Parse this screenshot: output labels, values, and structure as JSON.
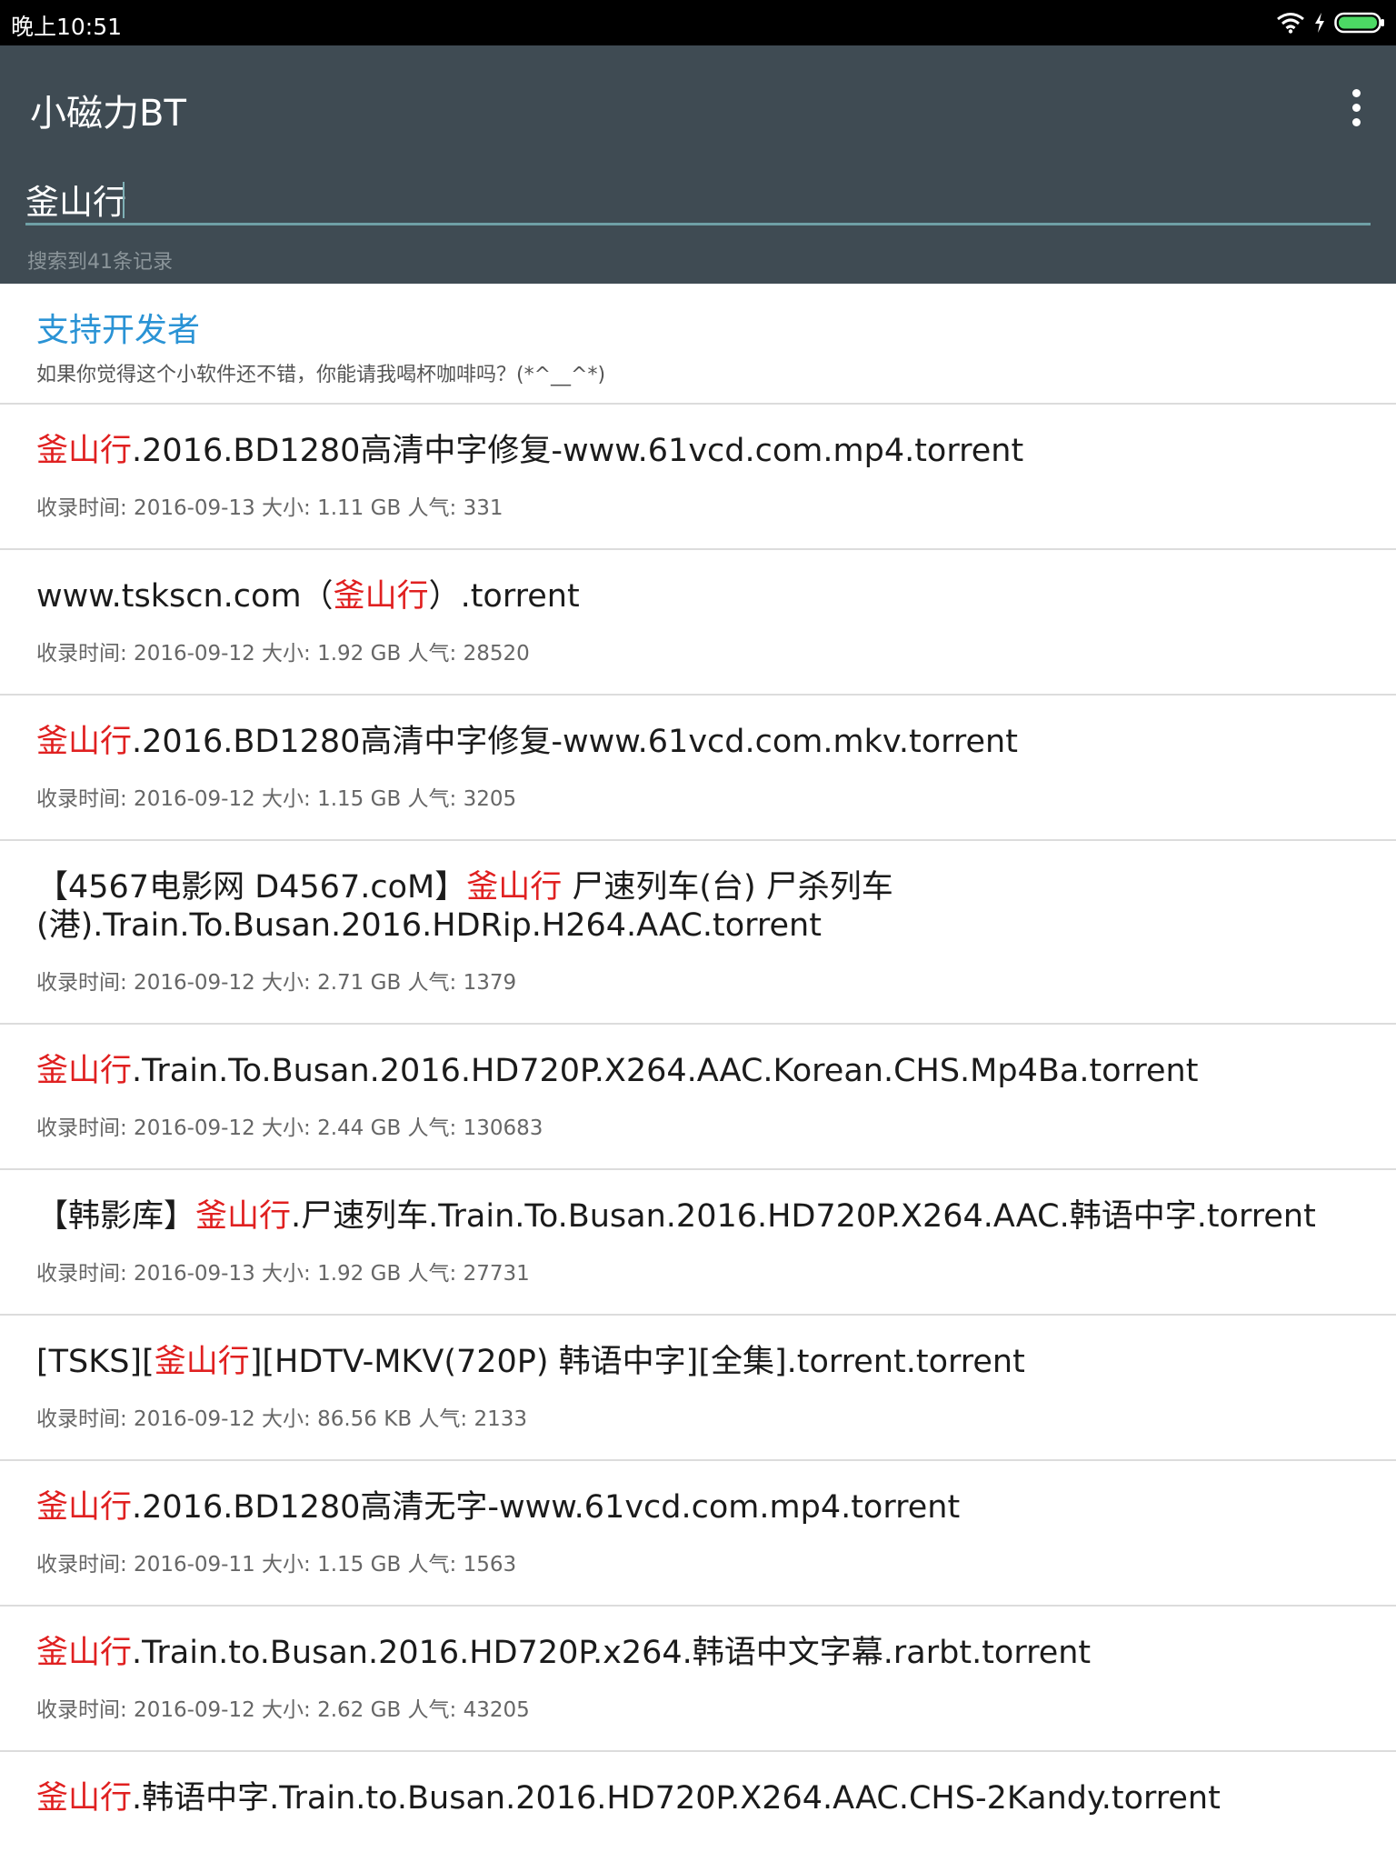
{
  "status_bar": {
    "time": "晚上10:51",
    "icons": [
      "wifi-icon",
      "charging-icon",
      "battery-icon"
    ],
    "battery_color": "#4cd964"
  },
  "app": {
    "title": "小磁力BT",
    "overflow_icon": "more-vert-icon"
  },
  "search": {
    "value": "釜山行",
    "count_text": "搜索到41条记录"
  },
  "support": {
    "title": "支持开发者",
    "description": "如果你觉得这个小软件还不错，你能请我喝杯咖啡吗？(*^__^*)"
  },
  "colors": {
    "appbar": "#3f4b53",
    "highlight": "#e02020",
    "link": "#2a93d5"
  },
  "results": [
    {
      "parts": [
        {
          "t": "釜山行",
          "hl": true
        },
        {
          "t": ".2016.BD1280高清中字修复-www.61vcd.com.mp4.torrent",
          "hl": false
        }
      ],
      "meta": "收录时间: 2016-09-13 大小: 1.11 GB 人气: 331"
    },
    {
      "parts": [
        {
          "t": "www.tskscn.com（",
          "hl": false
        },
        {
          "t": "釜山行",
          "hl": true
        },
        {
          "t": "）.torrent",
          "hl": false
        }
      ],
      "meta": "收录时间: 2016-09-12 大小: 1.92 GB 人气: 28520"
    },
    {
      "parts": [
        {
          "t": "釜山行",
          "hl": true
        },
        {
          "t": ".2016.BD1280高清中字修复-www.61vcd.com.mkv.torrent",
          "hl": false
        }
      ],
      "meta": "收录时间: 2016-09-12 大小: 1.15 GB 人气: 3205"
    },
    {
      "parts": [
        {
          "t": "【4567电影网 D4567.coM】",
          "hl": false
        },
        {
          "t": "釜山行",
          "hl": true
        },
        {
          "t": " 尸速列车(台) 尸杀列车(港).Train.To.Busan.2016.HDRip.H264.AAC.torrent",
          "hl": false
        }
      ],
      "meta": "收录时间: 2016-09-12 大小: 2.71 GB 人气: 1379"
    },
    {
      "parts": [
        {
          "t": "釜山行",
          "hl": true
        },
        {
          "t": ".Train.To.Busan.2016.HD720P.X264.AAC.Korean.CHS.Mp4Ba.torrent",
          "hl": false
        }
      ],
      "meta": "收录时间: 2016-09-12 大小: 2.44 GB 人气: 130683"
    },
    {
      "parts": [
        {
          "t": "【韩影库】",
          "hl": false
        },
        {
          "t": "釜山行",
          "hl": true
        },
        {
          "t": ".尸速列车.Train.To.Busan.2016.HD720P.X264.AAC.韩语中字.torrent",
          "hl": false
        }
      ],
      "meta": "收录时间: 2016-09-13 大小: 1.92 GB 人气: 27731"
    },
    {
      "parts": [
        {
          "t": "[TSKS][",
          "hl": false
        },
        {
          "t": "釜山行",
          "hl": true
        },
        {
          "t": "][HDTV-MKV(720P) 韩语中字][全集].torrent.torrent",
          "hl": false
        }
      ],
      "meta": "收录时间: 2016-09-12 大小: 86.56 KB 人气: 2133"
    },
    {
      "parts": [
        {
          "t": "釜山行",
          "hl": true
        },
        {
          "t": ".2016.BD1280高清无字-www.61vcd.com.mp4.torrent",
          "hl": false
        }
      ],
      "meta": "收录时间: 2016-09-11 大小: 1.15 GB 人气: 1563"
    },
    {
      "parts": [
        {
          "t": "釜山行",
          "hl": true
        },
        {
          "t": ".Train.to.Busan.2016.HD720P.x264.韩语中文字幕.rarbt.torrent",
          "hl": false
        }
      ],
      "meta": "收录时间: 2016-09-12 大小: 2.62 GB 人气: 43205"
    },
    {
      "parts": [
        {
          "t": "釜山行",
          "hl": true
        },
        {
          "t": ".韩语中字.Train.to.Busan.2016.HD720P.X264.AAC.CHS-2Kandy.torrent",
          "hl": false
        }
      ],
      "meta": ""
    }
  ]
}
